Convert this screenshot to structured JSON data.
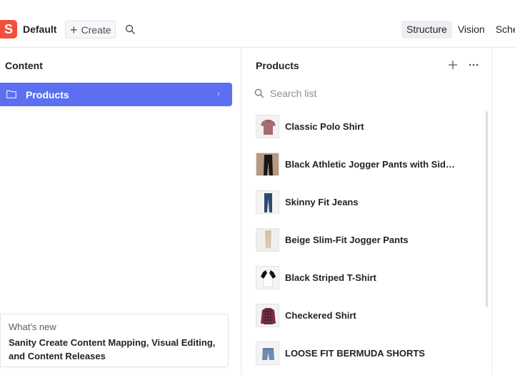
{
  "topbar": {
    "logo_letter": "S",
    "workspace": "Default",
    "create_label": "Create",
    "tools": [
      "Structure",
      "Vision",
      "Schema"
    ],
    "active_tool": "Structure"
  },
  "content_pane": {
    "title": "Content",
    "items": [
      {
        "label": "Products",
        "icon": "folder-icon",
        "selected": true
      }
    ]
  },
  "whats_new": {
    "kicker": "What's new",
    "headline": "Sanity Create Content Mapping, Visual Editing, and Content Releases"
  },
  "products_pane": {
    "title": "Products",
    "search_placeholder": "Search list",
    "items": [
      {
        "title": "Classic Polo Shirt",
        "thumb": "polo-shirt"
      },
      {
        "title": "Black Athletic Jogger Pants with Side S...",
        "thumb": "jogger-pants"
      },
      {
        "title": "Skinny Fit Jeans",
        "thumb": "jeans"
      },
      {
        "title": "Beige Slim-Fit Jogger Pants",
        "thumb": "beige-pants"
      },
      {
        "title": "Black Striped T-Shirt",
        "thumb": "raglan-tshirt"
      },
      {
        "title": "Checkered Shirt",
        "thumb": "checkered-shirt"
      },
      {
        "title": "LOOSE FIT BERMUDA SHORTS",
        "thumb": "denim-shorts"
      }
    ]
  },
  "colors": {
    "accent": "#5b6ff0",
    "logo": "#f0503d"
  }
}
